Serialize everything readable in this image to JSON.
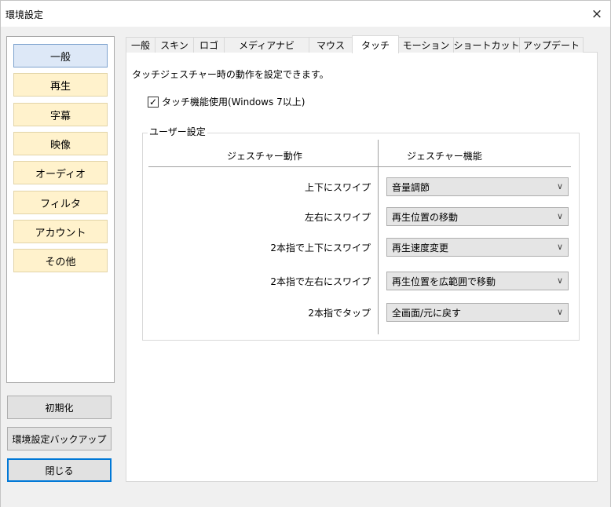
{
  "window": {
    "title": "環境設定",
    "close_glyph": "×"
  },
  "sidebar": {
    "items": [
      {
        "label": "一般",
        "selected": true
      },
      {
        "label": "再生",
        "selected": false
      },
      {
        "label": "字幕",
        "selected": false
      },
      {
        "label": "映像",
        "selected": false
      },
      {
        "label": "オーディオ",
        "selected": false
      },
      {
        "label": "フィルタ",
        "selected": false
      },
      {
        "label": "アカウント",
        "selected": false
      },
      {
        "label": "その他",
        "selected": false
      }
    ]
  },
  "buttons": {
    "reset": "初期化",
    "backup": "環境設定バックアップ",
    "close": "閉じる"
  },
  "tabs": [
    {
      "label": "一般",
      "active": false
    },
    {
      "label": "スキン",
      "active": false
    },
    {
      "label": "ロゴ",
      "active": false
    },
    {
      "label": "メディアナビ",
      "active": false
    },
    {
      "label": "マウス",
      "active": false
    },
    {
      "label": "タッチ",
      "active": true
    },
    {
      "label": "モーション",
      "active": false
    },
    {
      "label": "ショートカット",
      "active": false
    },
    {
      "label": "アップデート",
      "active": false
    }
  ],
  "touch": {
    "description": "タッチジェスチャー時の動作を設定できます。",
    "enable_label": "タッチ機能使用(Windows 7以上)",
    "enable_checked": true,
    "group_title": "ユーザー設定",
    "col_action": "ジェスチャー動作",
    "col_function": "ジェスチャー機能",
    "rows": [
      {
        "gesture": "上下にスワイプ",
        "function": "音量調節"
      },
      {
        "gesture": "左右にスワイプ",
        "function": "再生位置の移動"
      },
      {
        "gesture": "2本指で上下にスワイプ",
        "function": "再生速度変更"
      },
      {
        "gesture": "2本指で左右にスワイプ",
        "function": "再生位置を広範囲で移動"
      },
      {
        "gesture": "2本指でタップ",
        "function": "全画面/元に戻す"
      }
    ]
  },
  "colors": {
    "accent": "#0078d7",
    "sidebar_item": "#fff2cc",
    "sidebar_selected": "#dde8f7"
  }
}
